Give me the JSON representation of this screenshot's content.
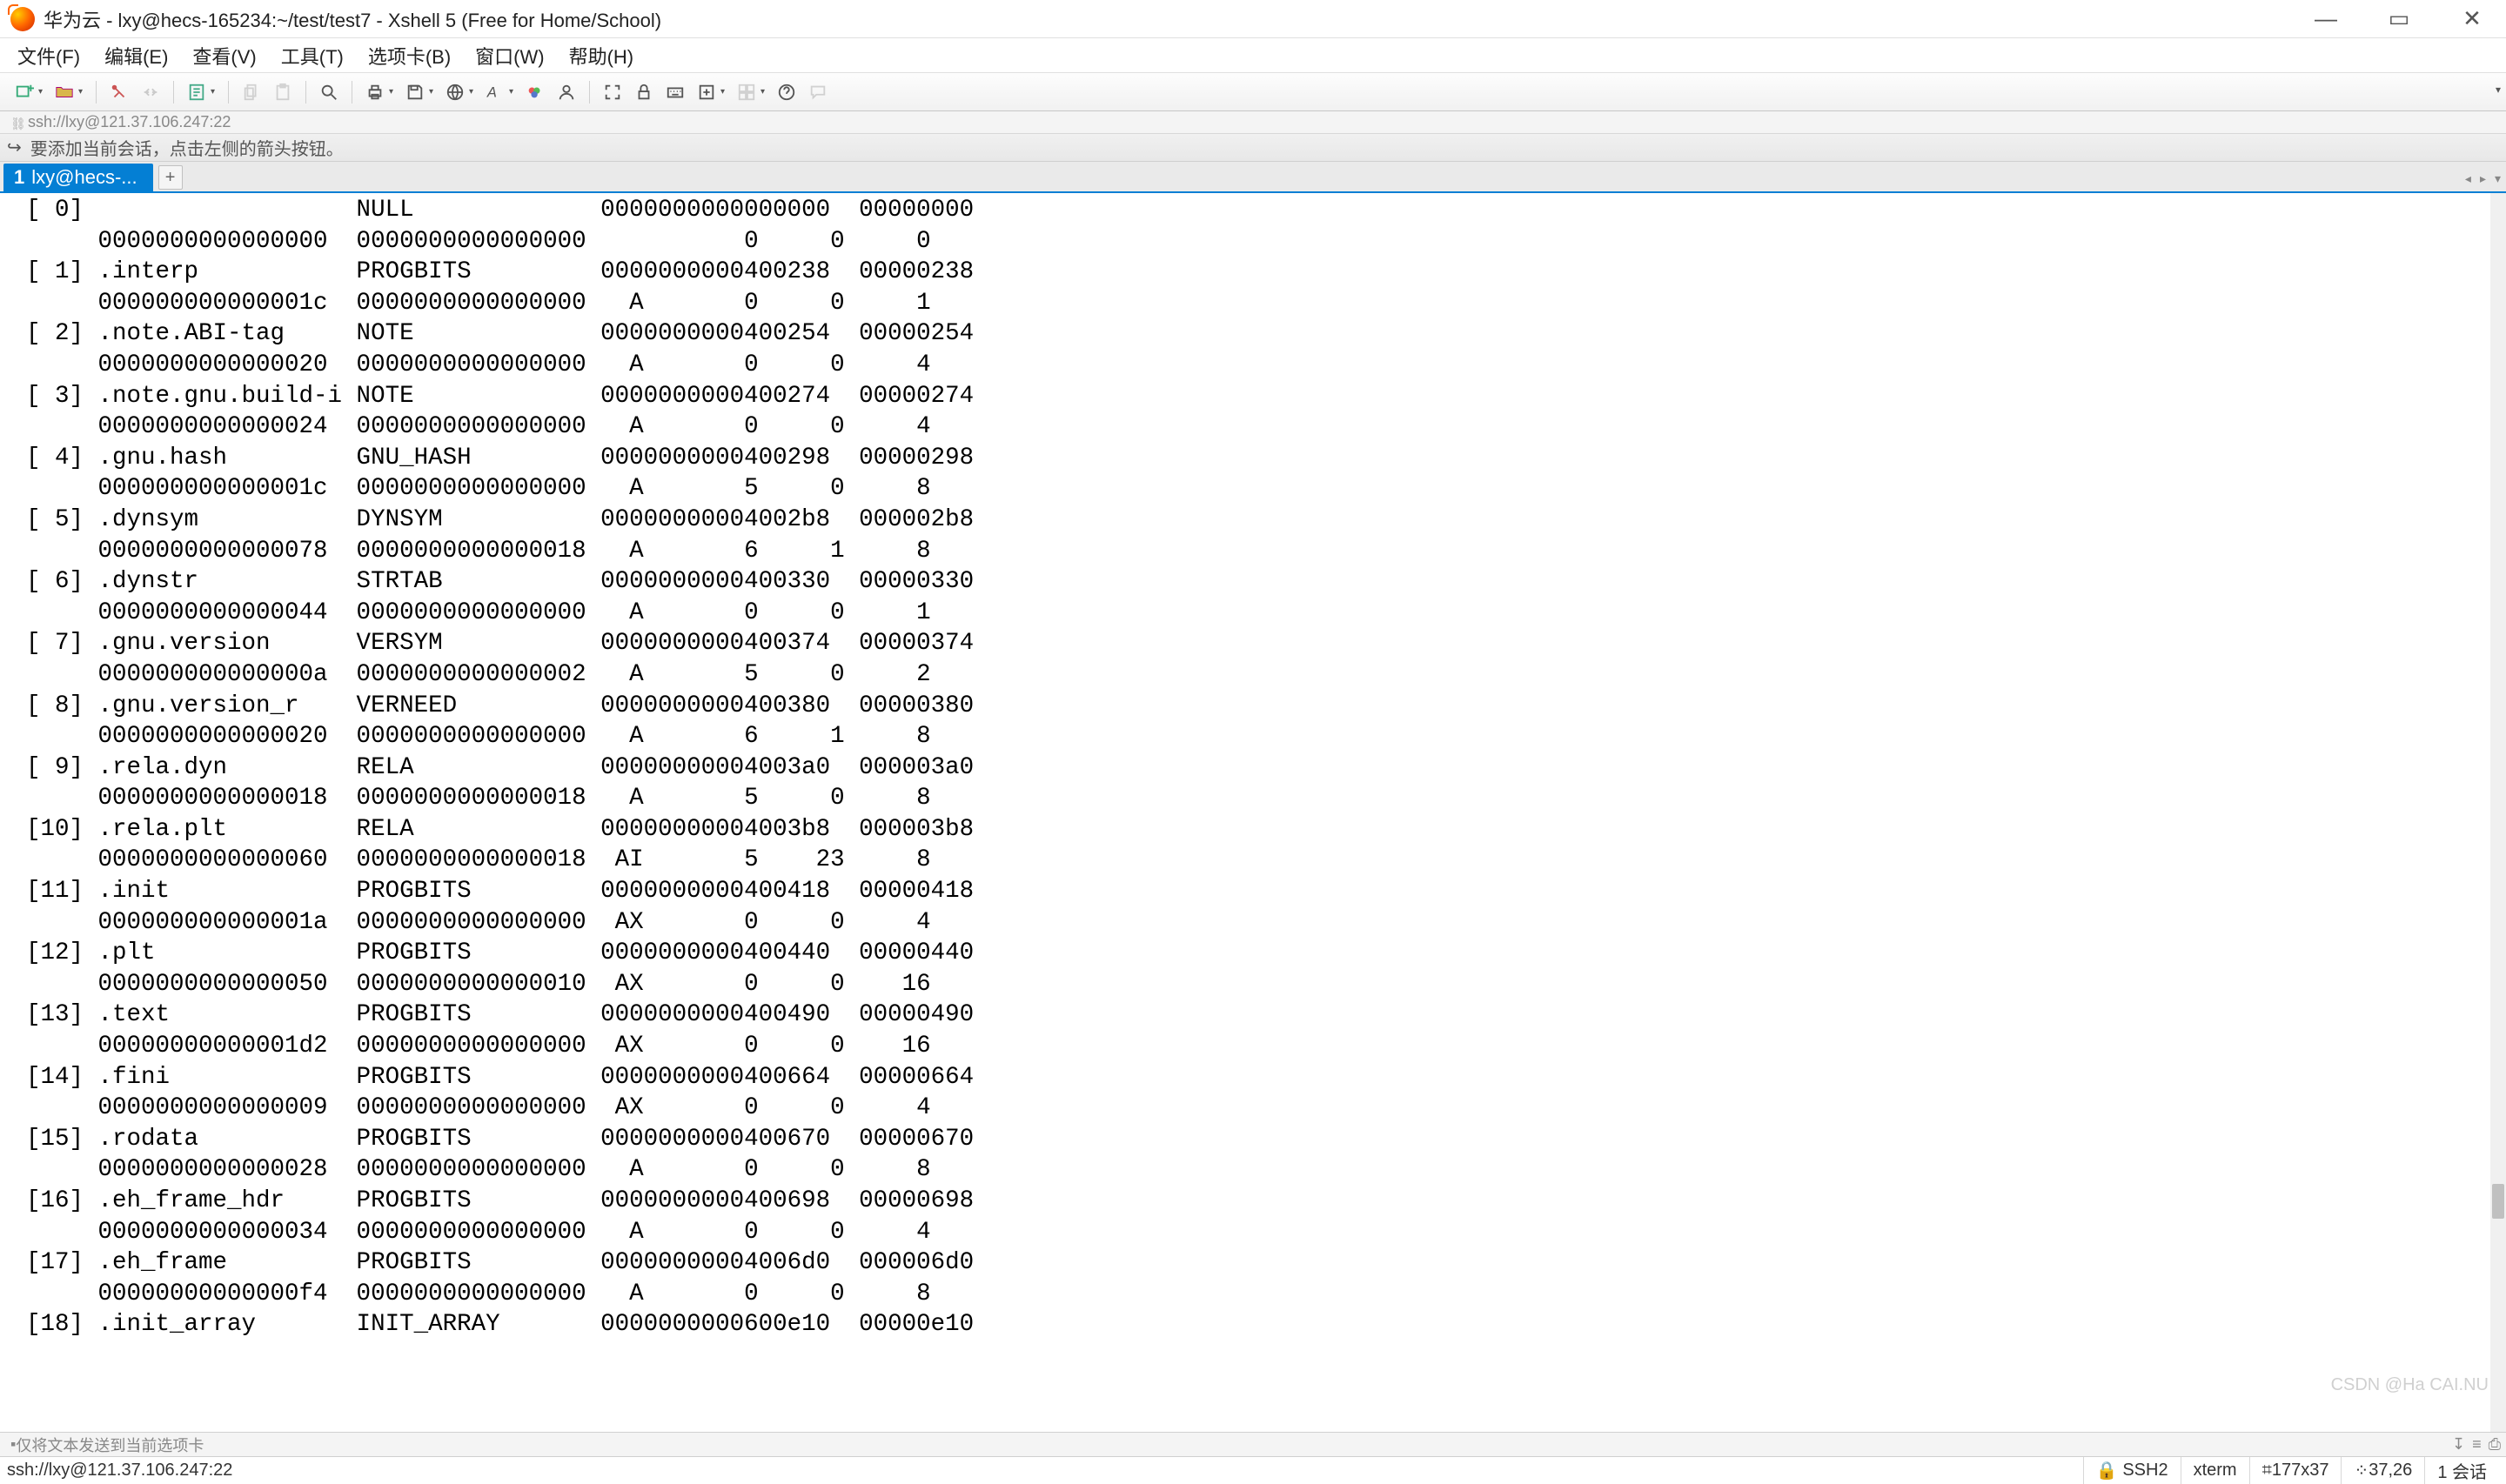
{
  "title": "华为云 - lxy@hecs-165234:~/test/test7 - Xshell 5 (Free for Home/School)",
  "menu": [
    "文件(F)",
    "编辑(E)",
    "查看(V)",
    "工具(T)",
    "选项卡(B)",
    "窗口(W)",
    "帮助(H)"
  ],
  "address": "ssh://lxy@121.37.106.247:22",
  "session_hint": "要添加当前会话，点击左侧的箭头按钮。",
  "tab": {
    "num": "1",
    "label": "lxy@hecs-..."
  },
  "status1": "仅将文本发送到当前选项卡",
  "status2": {
    "left": "ssh://lxy@121.37.106.247:22",
    "ssh": "SSH2",
    "term": "xterm",
    "size": "177x37",
    "cursor": "37,26",
    "sessions": "1 会话"
  },
  "watermark": "CSDN @Ha CAI.NU",
  "terminal_lines": [
    "[ 0]                   NULL             0000000000000000  00000000",
    "     0000000000000000  0000000000000000           0     0     0",
    "[ 1] .interp           PROGBITS         0000000000400238  00000238",
    "     000000000000001c  0000000000000000   A       0     0     1",
    "[ 2] .note.ABI-tag     NOTE             0000000000400254  00000254",
    "     0000000000000020  0000000000000000   A       0     0     4",
    "[ 3] .note.gnu.build-i NOTE             0000000000400274  00000274",
    "     0000000000000024  0000000000000000   A       0     0     4",
    "[ 4] .gnu.hash         GNU_HASH         0000000000400298  00000298",
    "     000000000000001c  0000000000000000   A       5     0     8",
    "[ 5] .dynsym           DYNSYM           00000000004002b8  000002b8",
    "     0000000000000078  0000000000000018   A       6     1     8",
    "[ 6] .dynstr           STRTAB           0000000000400330  00000330",
    "     0000000000000044  0000000000000000   A       0     0     1",
    "[ 7] .gnu.version      VERSYM           0000000000400374  00000374",
    "     000000000000000a  0000000000000002   A       5     0     2",
    "[ 8] .gnu.version_r    VERNEED          0000000000400380  00000380",
    "     0000000000000020  0000000000000000   A       6     1     8",
    "[ 9] .rela.dyn         RELA             00000000004003a0  000003a0",
    "     0000000000000018  0000000000000018   A       5     0     8",
    "[10] .rela.plt         RELA             00000000004003b8  000003b8",
    "     0000000000000060  0000000000000018  AI       5    23     8",
    "[11] .init             PROGBITS         0000000000400418  00000418",
    "     000000000000001a  0000000000000000  AX       0     0     4",
    "[12] .plt              PROGBITS         0000000000400440  00000440",
    "     0000000000000050  0000000000000010  AX       0     0    16",
    "[13] .text             PROGBITS         0000000000400490  00000490",
    "     00000000000001d2  0000000000000000  AX       0     0    16",
    "[14] .fini             PROGBITS         0000000000400664  00000664",
    "     0000000000000009  0000000000000000  AX       0     0     4",
    "[15] .rodata           PROGBITS         0000000000400670  00000670",
    "     0000000000000028  0000000000000000   A       0     0     8",
    "[16] .eh_frame_hdr     PROGBITS         0000000000400698  00000698",
    "     0000000000000034  0000000000000000   A       0     0     4",
    "[17] .eh_frame         PROGBITS         00000000004006d0  000006d0",
    "     00000000000000f4  0000000000000000   A       0     0     8",
    "[18] .init_array       INIT_ARRAY       0000000000600e10  00000e10"
  ]
}
